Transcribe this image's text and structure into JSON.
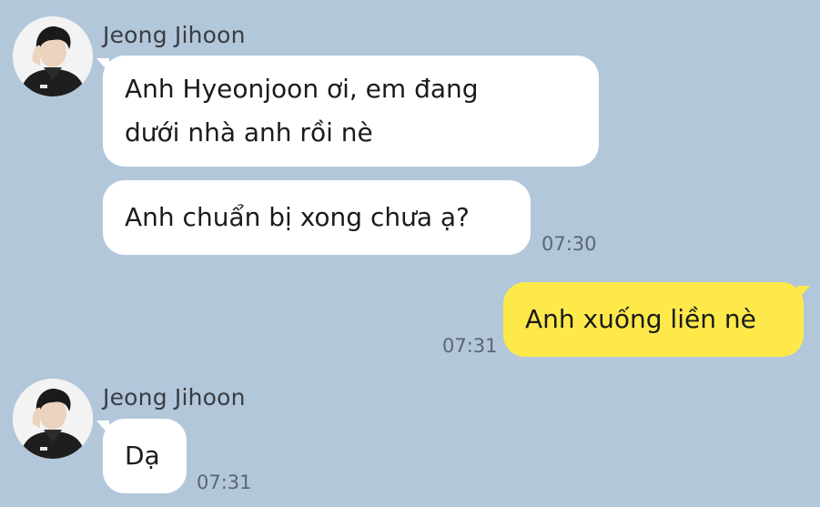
{
  "conversation": {
    "messages": [
      {
        "direction": "incoming",
        "sender": "Jeong Jihoon",
        "avatar_icon": "profile-photo-avatar",
        "lines": [
          "Anh Hyeonjoon ơi, em đang",
          "dưới nhà anh rồi nè"
        ]
      },
      {
        "direction": "incoming",
        "text": "Anh chuẩn bị xong chưa ạ?",
        "time": "07:30"
      },
      {
        "direction": "outgoing",
        "text": "Anh xuống liền nè",
        "time": "07:31"
      },
      {
        "direction": "incoming",
        "sender": "Jeong Jihoon",
        "avatar_icon": "profile-photo-avatar",
        "text": "Dạ",
        "time": "07:31"
      }
    ]
  },
  "colors": {
    "background": "#b2c7da",
    "incoming_bubble": "#ffffff",
    "outgoing_bubble": "#fde94a"
  }
}
